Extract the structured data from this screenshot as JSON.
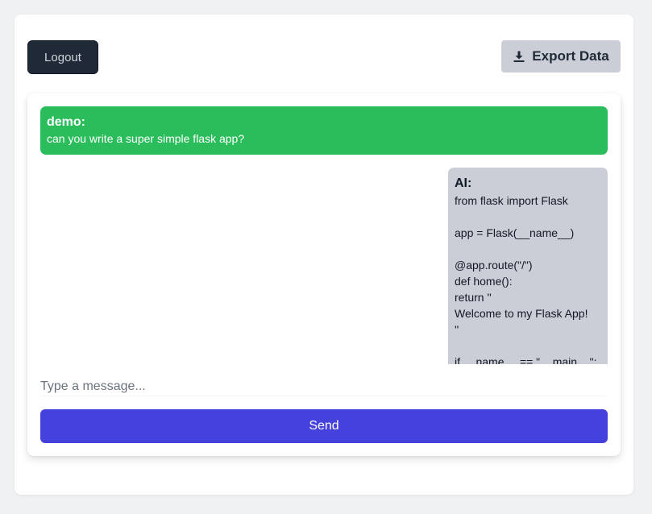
{
  "header": {
    "logout_label": "Logout",
    "export_label": "Export Data",
    "export_icon": "download-icon"
  },
  "messages": [
    {
      "sender": "demo:",
      "text": "can you write a super simple flask app?",
      "color": "#2bbd5b"
    },
    {
      "sender": "AI:",
      "lines": [
        "from flask import Flask",
        "",
        "app = Flask(__name__)",
        "",
        "@app.route(\"/\")",
        "def home():",
        "return ''",
        "Welcome to my Flask App!",
        "''",
        "",
        "if __name__ == \"__main__\":"
      ],
      "color": "#cbced6"
    }
  ],
  "composer": {
    "placeholder": "Type a message...",
    "value": "",
    "send_label": "Send",
    "send_color": "#4541dc"
  }
}
